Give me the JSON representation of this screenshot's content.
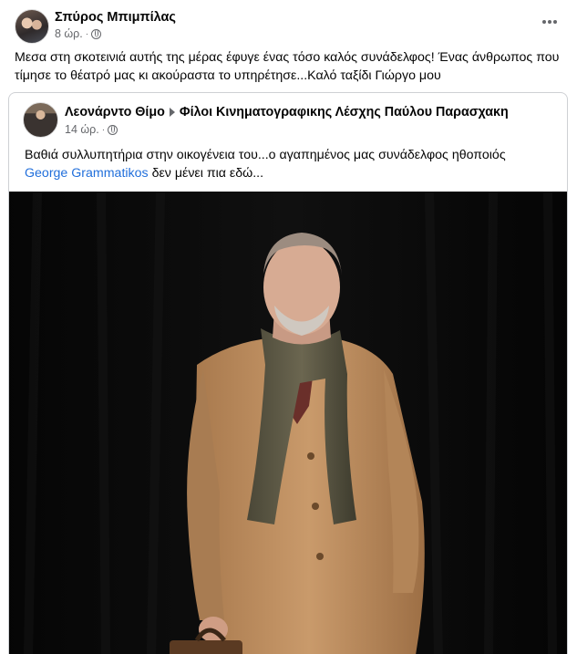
{
  "post": {
    "author": "Σπύρος Μπιμπίλας",
    "time": "8 ώρ.",
    "text": "Μεσα στη σκοτεινιά αυτής της μέρας έφυγε ένας τόσο καλός συνάδελφος! Ένας άνθρωπος που τίμησε το θέατρό μας  κι ακούραστα το υπηρέτησε...Καλό ταξίδι Γιώργο μου"
  },
  "shared": {
    "author": "Λεονάρντο Θίμο",
    "group": "Φίλοι Κινηματογραφικης Λέσχης Παύλου Παρασχακη",
    "time": "14 ώρ.",
    "text_before": "Βαθιά συλλυπητήρια στην οικογένεια του...ο αγαπημένος μας συνάδελφος ηθοποιός",
    "mention": "George Grammatikos",
    "text_after": " δεν μένει πια εδώ..."
  },
  "icons": {
    "privacy": "globe-icon",
    "menu": "more-options-icon",
    "separator": "caret-right-icon"
  },
  "colors": {
    "link": "#216fdb",
    "secondary_text": "#65676b",
    "border": "#ced0d4"
  }
}
